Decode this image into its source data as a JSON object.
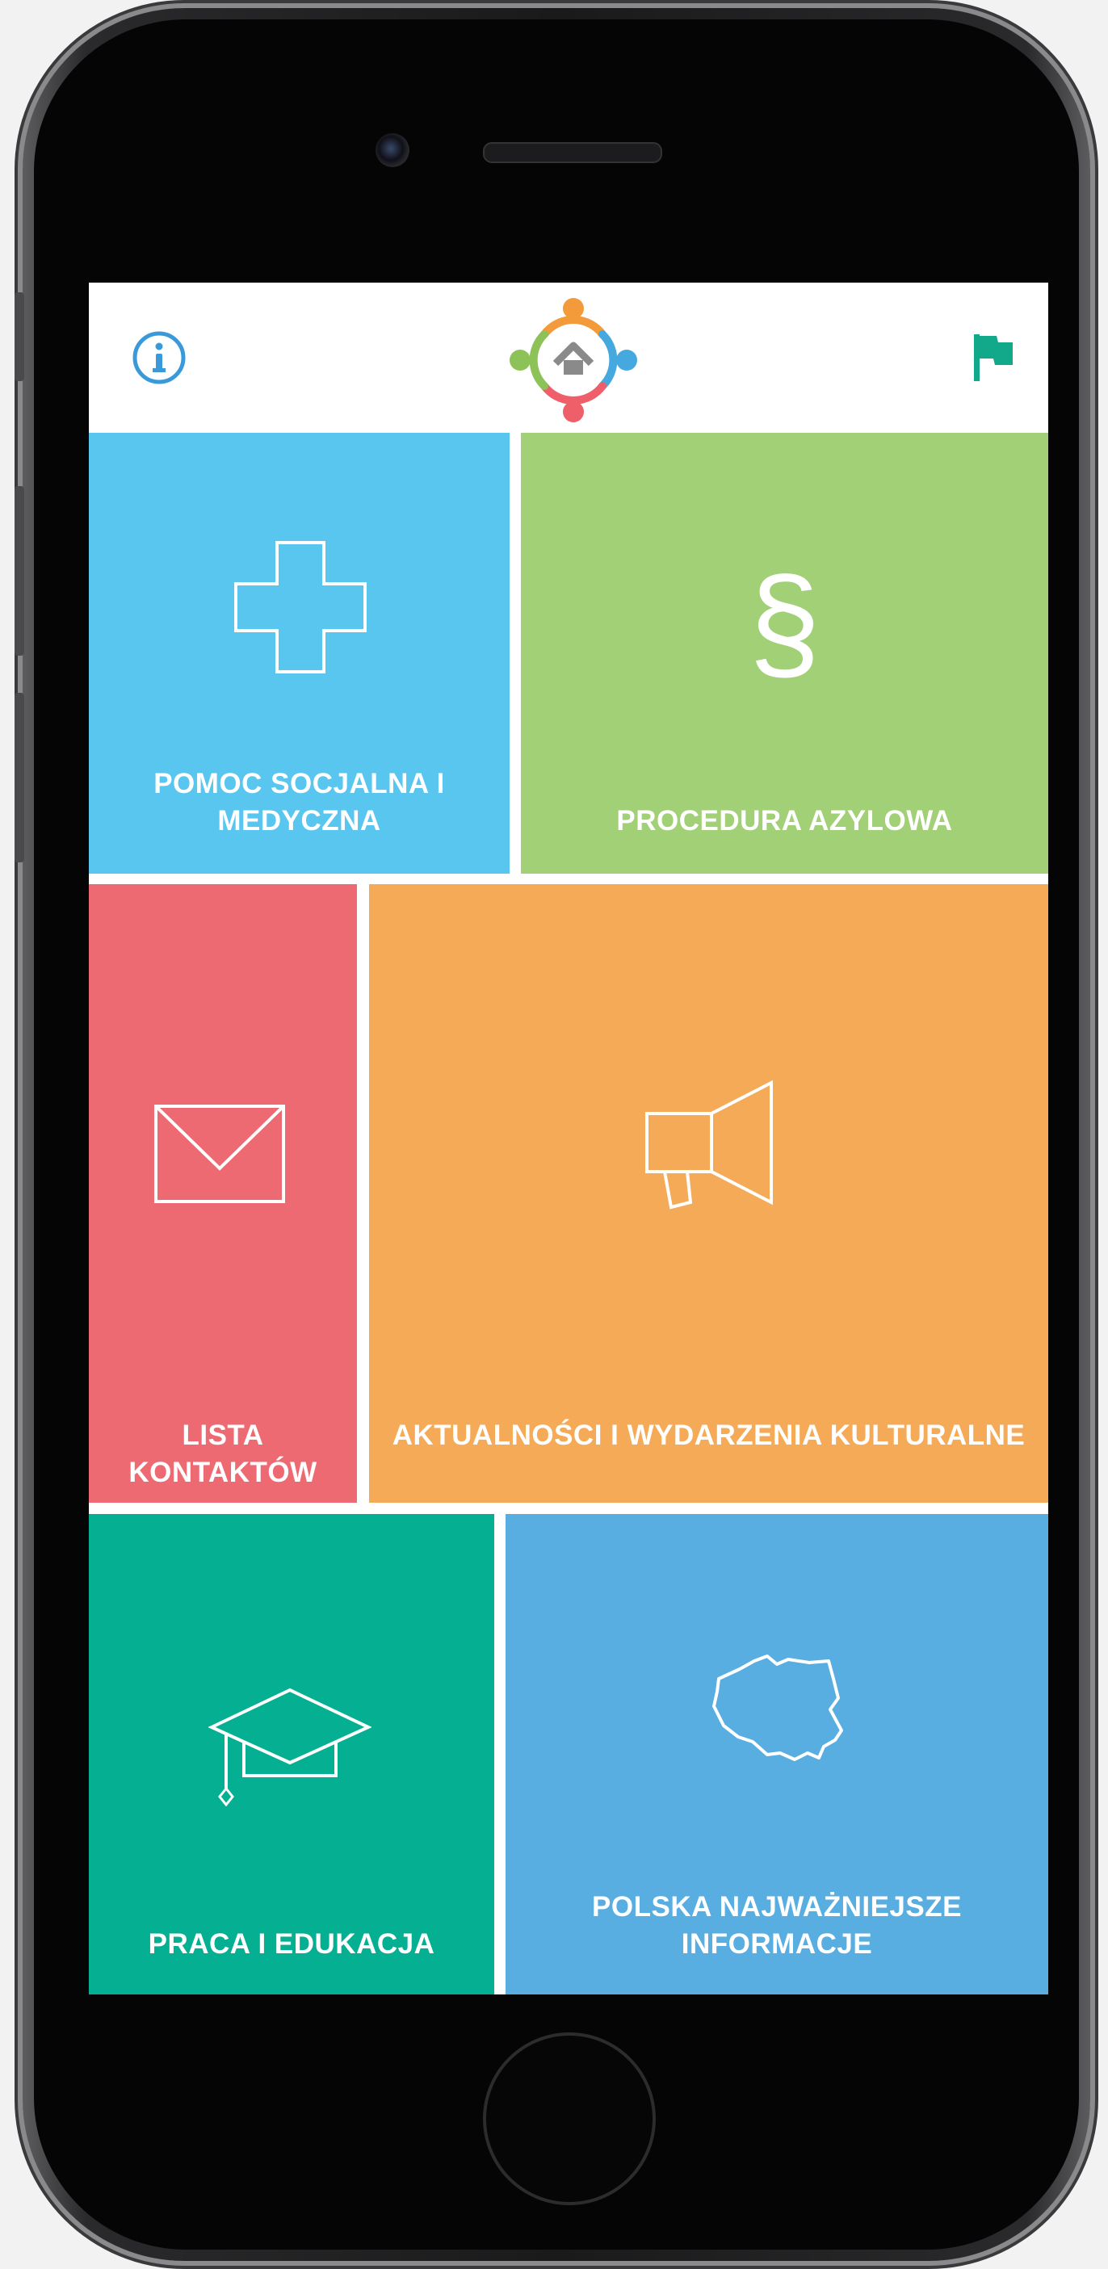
{
  "header": {
    "info_icon": "info-circle-icon",
    "logo_icon": "refugee-home-logo-icon",
    "flag_icon": "flag-icon",
    "accent_info": "#3a9ad9",
    "accent_flag": "#12a88a"
  },
  "tiles": [
    {
      "label": "POMOC SOCJALNA I MEDYCZNA",
      "icon": "medical-cross-icon",
      "color": "#58c6ef"
    },
    {
      "label": "PROCEDURA AZYLOWA",
      "icon": "paragraph-icon",
      "color": "#a1d076"
    },
    {
      "label": "LISTA KONTAKTÓW",
      "icon": "envelope-icon",
      "color": "#ee6a72"
    },
    {
      "label": "AKTUALNOŚCI I WYDARZENIA KULTURALNE",
      "icon": "megaphone-icon",
      "color": "#f5aa58"
    },
    {
      "label": "PRACA I EDUKACJA",
      "icon": "graduation-cap-icon",
      "color": "#05b092"
    },
    {
      "label": "POLSKA NAJWAŻNIEJSZE INFORMACJE",
      "icon": "poland-map-icon",
      "color": "#58ade1"
    }
  ],
  "symbols": {
    "paragraph": "§"
  }
}
